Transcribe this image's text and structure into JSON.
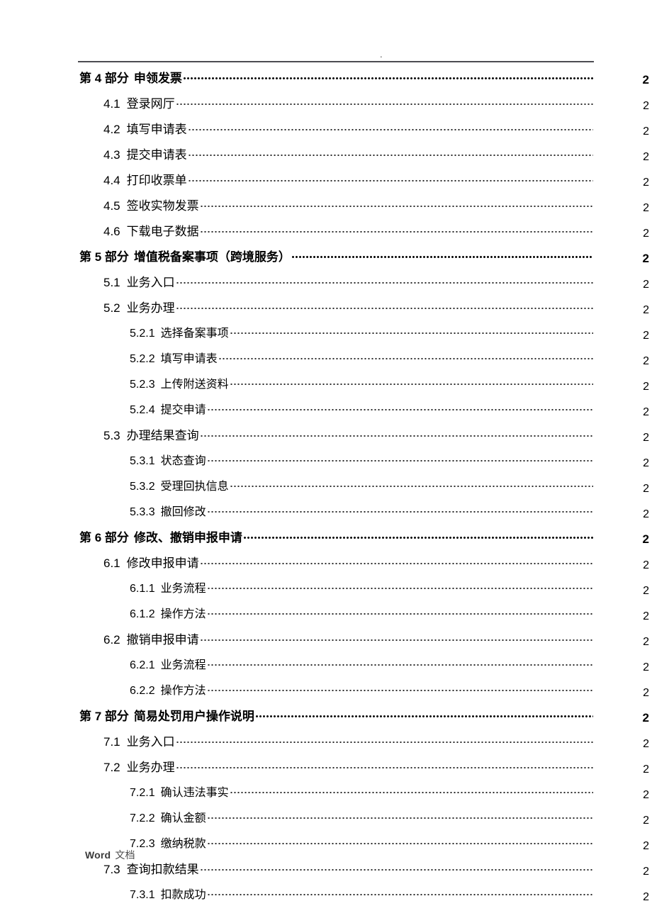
{
  "document": {
    "type": "table-of-contents",
    "header": {
      "dot_mark": ".",
      "rule_color": "#4c4c52"
    },
    "footer": {
      "label_latin": "Word",
      "label_cjk": "文档"
    }
  },
  "toc": {
    "entries": [
      {
        "level": 1,
        "number": "第 4 部分",
        "title": "申领发票",
        "page": "2"
      },
      {
        "level": 2,
        "number": "4.1",
        "title": "登录网厅",
        "page": "2"
      },
      {
        "level": 2,
        "number": "4.2",
        "title": "填写申请表",
        "page": "2"
      },
      {
        "level": 2,
        "number": "4.3",
        "title": "提交申请表",
        "page": "2"
      },
      {
        "level": 2,
        "number": "4.4",
        "title": "打印收票单",
        "page": "2"
      },
      {
        "level": 2,
        "number": "4.5",
        "title": "签收实物发票",
        "page": "2"
      },
      {
        "level": 2,
        "number": "4.6",
        "title": "下载电子数据",
        "page": "2"
      },
      {
        "level": 1,
        "number": "第 5 部分",
        "title": "增值税备案事项（跨境服务）",
        "page": "2"
      },
      {
        "level": 2,
        "number": "5.1",
        "title": "业务入口",
        "page": "2"
      },
      {
        "level": 2,
        "number": "5.2",
        "title": "业务办理",
        "page": "2"
      },
      {
        "level": 3,
        "number": "5.2.1",
        "title": "选择备案事项",
        "page": "2"
      },
      {
        "level": 3,
        "number": "5.2.2",
        "title": "填写申请表",
        "page": "2"
      },
      {
        "level": 3,
        "number": "5.2.3",
        "title": "上传附送资料",
        "page": "2"
      },
      {
        "level": 3,
        "number": "5.2.4",
        "title": "提交申请",
        "page": "2"
      },
      {
        "level": 2,
        "number": "5.3",
        "title": "办理结果查询",
        "page": "2"
      },
      {
        "level": 3,
        "number": "5.3.1",
        "title": "状态查询",
        "page": "2"
      },
      {
        "level": 3,
        "number": "5.3.2",
        "title": "受理回执信息",
        "page": "2"
      },
      {
        "level": 3,
        "number": "5.3.3",
        "title": "撤回修改",
        "page": "2"
      },
      {
        "level": 1,
        "number": "第 6 部分",
        "title": "修改、撤销申报申请",
        "page": "2"
      },
      {
        "level": 2,
        "number": "6.1",
        "title": "修改申报申请",
        "page": "2"
      },
      {
        "level": 3,
        "number": "6.1.1",
        "title": "业务流程",
        "page": "2"
      },
      {
        "level": 3,
        "number": "6.1.2",
        "title": "操作方法",
        "page": "2"
      },
      {
        "level": 2,
        "number": "6.2",
        "title": "撤销申报申请",
        "page": "2"
      },
      {
        "level": 3,
        "number": "6.2.1",
        "title": "业务流程",
        "page": "2"
      },
      {
        "level": 3,
        "number": "6.2.2",
        "title": "操作方法",
        "page": "2"
      },
      {
        "level": 1,
        "number": "第 7 部分",
        "title": "简易处罚用户操作说明",
        "page": "2"
      },
      {
        "level": 2,
        "number": "7.1",
        "title": "业务入口",
        "page": "2"
      },
      {
        "level": 2,
        "number": "7.2",
        "title": "业务办理",
        "page": "2"
      },
      {
        "level": 3,
        "number": "7.2.1",
        "title": "确认违法事实",
        "page": "2"
      },
      {
        "level": 3,
        "number": "7.2.2",
        "title": "确认金额",
        "page": "2"
      },
      {
        "level": 3,
        "number": "7.2.3",
        "title": "缴纳税款",
        "page": "2"
      },
      {
        "level": 2,
        "number": "7.3",
        "title": "查询扣款结果",
        "page": "2"
      },
      {
        "level": 3,
        "number": "7.3.1",
        "title": "扣款成功",
        "page": "2"
      }
    ]
  }
}
